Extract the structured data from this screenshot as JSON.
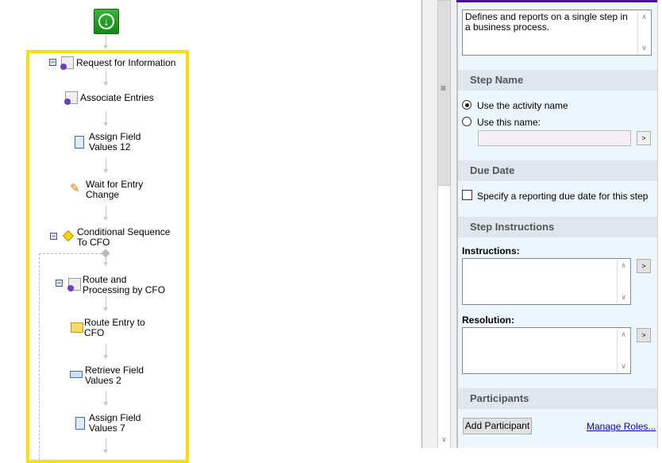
{
  "workflow": {
    "start_icon": "green-down-arrow-start",
    "nodes": [
      {
        "label": "Request for Information",
        "icon": "gear-document-icon",
        "collapsible": true
      },
      {
        "label": "Associate Entries",
        "icon": "gear-link-icon",
        "collapsible": false
      },
      {
        "label": "Assign Field\nValues 12",
        "icon": "list-document-icon",
        "collapsible": false
      },
      {
        "label": "Wait for Entry\nChange",
        "icon": "pencil-clock-icon",
        "collapsible": false
      },
      {
        "label": "Conditional Sequence\nTo CFO",
        "icon": "diamond-condition-icon",
        "collapsible": true
      },
      {
        "label": "Route and\nProcessing by CFO",
        "icon": "gear-document-icon",
        "collapsible": true
      },
      {
        "label": "Route Entry to\nCFO",
        "icon": "folder-star-icon",
        "collapsible": false
      },
      {
        "label": "Retrieve Field\nValues 2",
        "icon": "field-question-icon",
        "collapsible": false
      },
      {
        "label": "Assign Field\nValues 7",
        "icon": "list-document-icon",
        "collapsible": false
      }
    ]
  },
  "properties": {
    "description": "Defines and reports on a single step in a business process.",
    "step_name": {
      "title": "Step Name",
      "option_activity": "Use the activity name",
      "option_custom": "Use this name:",
      "selected": "activity",
      "custom_value": "",
      "expand_button": ">"
    },
    "due_date": {
      "title": "Due Date",
      "checkbox_label": "Specify a reporting due date for this step",
      "checked": false
    },
    "step_instructions": {
      "title": "Step Instructions",
      "instructions_label": "Instructions:",
      "instructions_value": "",
      "resolution_label": "Resolution:",
      "resolution_value": "",
      "expand_button": ">"
    },
    "participants": {
      "title": "Participants",
      "add_button": "Add Participant",
      "manage_link": "Manage Roles..."
    }
  },
  "colors": {
    "highlight": "#f5e000",
    "accent": "#4b0fa0",
    "start": "#1e9e1e"
  }
}
